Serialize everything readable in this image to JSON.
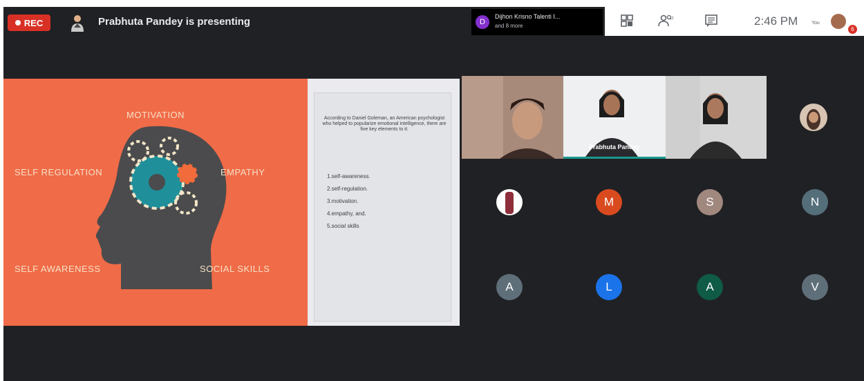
{
  "recording": {
    "label": "REC"
  },
  "presenting": {
    "text": "Prabhuta Pandey is presenting"
  },
  "notification": {
    "avatar_letter": "D",
    "name": "Dijhon Krisno Talenti I...",
    "subtitle": "and 8 more"
  },
  "toolbar": {
    "time": "2:46 PM",
    "you_label": "You",
    "badge_count": "6"
  },
  "slide": {
    "head_labels": {
      "motivation": "MOTIVATION",
      "self_regulation": "SELF REGULATION",
      "empathy": "EMPATHY",
      "self_awareness": "SELF AWARENESS",
      "social_skills": "SOCIAL SKILLS"
    },
    "intro": "According to Daniel Goleman, an American psychologist who helped to popularize emotional intelligence, there are five key elements to it:",
    "points": [
      "1.self-awareness.",
      "2.self-regulation.",
      "3.motivation.",
      "4.empathy, and.",
      "5.social skills"
    ]
  },
  "participants": {
    "presenter_name": "Prabhuta Pandey",
    "tiles": [
      {
        "letter": "M",
        "color": "#d94a1f"
      },
      {
        "letter": "S",
        "color": "#a1887f"
      },
      {
        "letter": "N",
        "color": "#546e7a"
      },
      {
        "letter": "A",
        "color": "#5f6f7a"
      },
      {
        "letter": "L",
        "color": "#1a73e8"
      },
      {
        "letter": "A",
        "color": "#0f5b45"
      },
      {
        "letter": "V",
        "color": "#5f6f7a"
      }
    ]
  }
}
